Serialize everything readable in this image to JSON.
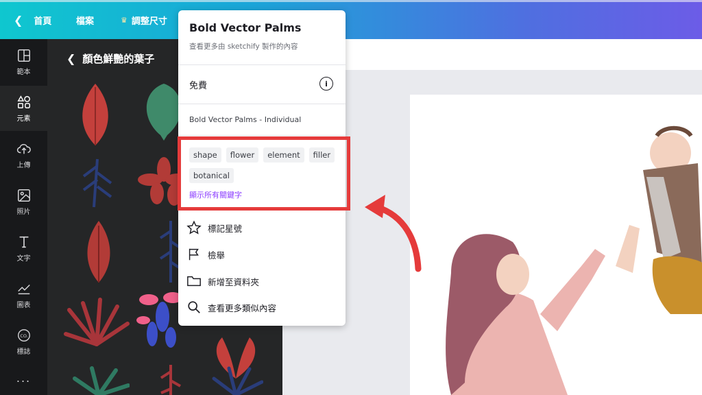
{
  "topbar": {
    "home": "首頁",
    "file": "檔案",
    "resize": "調整尺寸"
  },
  "rail": [
    {
      "label": "範本",
      "icon": "template-icon"
    },
    {
      "label": "元素",
      "icon": "elements-icon"
    },
    {
      "label": "上傳",
      "icon": "upload-icon"
    },
    {
      "label": "照片",
      "icon": "photo-icon"
    },
    {
      "label": "文字",
      "icon": "text-icon"
    },
    {
      "label": "圖表",
      "icon": "chart-icon"
    },
    {
      "label": "標誌",
      "icon": "logo-icon"
    }
  ],
  "rail_more": "...",
  "panel": {
    "title": "顏色鮮艷的葉子"
  },
  "popup": {
    "title": "Bold Vector Palms",
    "subtitle": "查看更多由 sketchify 製作的內容",
    "price": "免費",
    "license": "Bold Vector Palms - Individual",
    "tags": [
      "shape",
      "flower",
      "element",
      "filler",
      "botanical"
    ],
    "show_keywords": "顯示所有關鍵字",
    "actions": [
      {
        "label": "標記星號",
        "icon": "star-icon"
      },
      {
        "label": "檢舉",
        "icon": "flag-icon"
      },
      {
        "label": "新增至資料夾",
        "icon": "folder-icon"
      },
      {
        "label": "查看更多類似內容",
        "icon": "search-icon"
      }
    ]
  },
  "colors": {
    "accent_red": "#e53b3b",
    "link_purple": "#8b3dff",
    "panel_dark": "#252627",
    "rail_dark": "#18191b"
  }
}
